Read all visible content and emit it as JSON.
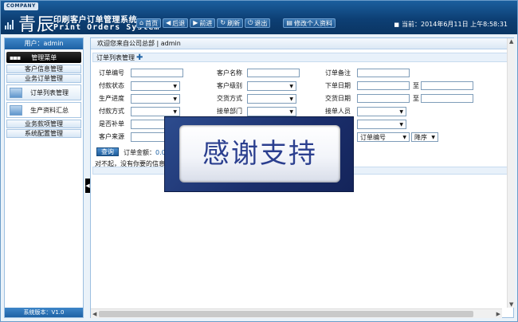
{
  "header": {
    "company_tag": "COMPANY",
    "logo_cn": "青辰",
    "logo_title": "印刷客户订单管理系统",
    "logo_en": "Print Orders System",
    "nav": [
      {
        "label": "首页",
        "icon": "home-icon"
      },
      {
        "label": "后退",
        "icon": "back-arrow-icon"
      },
      {
        "label": "前进",
        "icon": "forward-arrow-icon"
      },
      {
        "label": "刷新",
        "icon": "refresh-icon"
      },
      {
        "label": "退出",
        "icon": "power-icon"
      }
    ],
    "profile_label": "修改个人资料",
    "date_text": "当前：2014年6月11日 上午8:58:31"
  },
  "sidebar": {
    "user": "用户：admin",
    "menu_head": "管理菜单",
    "items": [
      {
        "label": "客户信息管理"
      },
      {
        "label": "业务订单管理"
      }
    ],
    "sub_items": [
      {
        "label": "订单列表管理"
      },
      {
        "label": "生产资料汇总"
      }
    ],
    "items2": [
      {
        "label": "业务款项管理"
      },
      {
        "label": "系统配置管理"
      }
    ],
    "version": "系统版本：V1.0"
  },
  "content": {
    "welcome": "欢迎您来自公司总部 | admin",
    "panel_title": "订单列表管理",
    "form": {
      "order_no": "订单编号",
      "customer_name": "客户名称",
      "order_note": "订单备注",
      "pay_status": "付款状态",
      "customer_level": "客户级别",
      "order_date": "下单日期",
      "to1": "至",
      "progress": "生产进度",
      "delivery_method": "交货方式",
      "delivery_date": "交货日期",
      "to2": "至",
      "pay_method": "付款方式",
      "receive_dept": "接单部门",
      "receiver": "接单人员",
      "reissue": "是否补单",
      "customer_source": "客户来源",
      "sort_field": "订单编号",
      "sort_order": "降序"
    },
    "query_label": "查询",
    "amount_label": "订单金额：",
    "amount_value": "0.00",
    "no_data": "对不起，没有你要的信息！"
  },
  "overlay": {
    "text": "感谢支持"
  }
}
